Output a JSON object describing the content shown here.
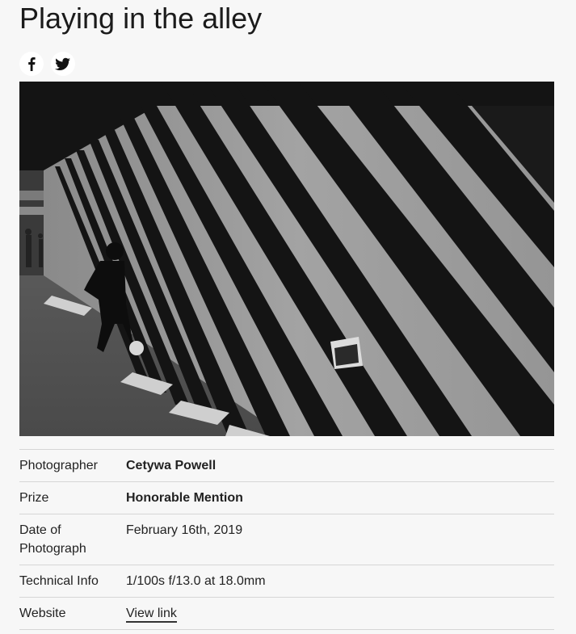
{
  "page": {
    "title": "Playing in the alley"
  },
  "share": {
    "items": [
      {
        "name": "facebook",
        "icon": "facebook-icon"
      },
      {
        "name": "twitter",
        "icon": "twitter-bird-icon"
      }
    ]
  },
  "photo": {
    "description_icon": "photograph",
    "colors": {
      "shadow": "#141414",
      "wall": "#9c9c9c",
      "ground": "#5e5e5e"
    }
  },
  "details": {
    "rows": [
      {
        "label": "Photographer",
        "value": "Cetywa Powell"
      },
      {
        "label": "Prize",
        "value": "Honorable Mention"
      },
      {
        "label_line1": "Date of",
        "label_line2": "Photograph",
        "value": "February 16th, 2019"
      },
      {
        "label": "Technical Info",
        "value": "1/100s f/13.0 at 18.0mm"
      },
      {
        "label": "Website",
        "value": "View link"
      }
    ]
  }
}
